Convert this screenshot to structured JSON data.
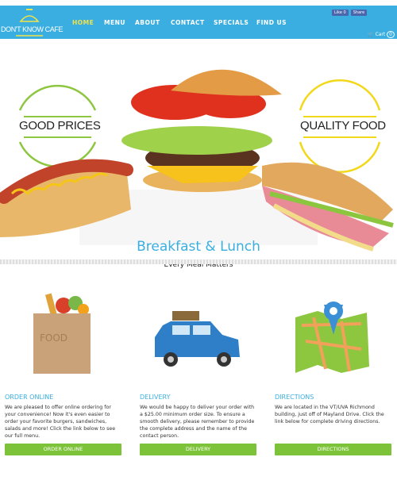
{
  "header": {
    "logo_text": "DON'T KNOW CAFE",
    "nav": [
      "HOME",
      "MENU",
      "ABOUT",
      "CONTACT",
      "SPECIALS",
      "FIND US"
    ],
    "active": "HOME",
    "fb_like": "Like 0",
    "fb_share": "Share",
    "cart": "Cart",
    "cart_count": "0"
  },
  "hero": {
    "left_badge": "GOOD PRICES",
    "right_badge": "QUALITY FOOD",
    "title": "Breakfast & Lunch",
    "subtitle": "Every Meal Matters",
    "bag_label": "FOOD"
  },
  "features": [
    {
      "title": "ORDER ONLINE",
      "text": "We are pleased to offer online ordering for your convenience! Now it's even easier to order your favorite burgers, sandwiches, salads and more! Click the link below to see our full menu.",
      "button": "ORDER ONLINE"
    },
    {
      "title": "DELIVERY",
      "text": "We would be happy to deliver your order with a $25.00 minimum order size. To ensure a smooth delivery, please remember to provide the complete address and the name of the contact person.",
      "button": "DELIVERY"
    },
    {
      "title": "DIRECTIONS",
      "text": "We are located in the VT/UVA Richmond building, just off of Mayland Drive. Click the link below for complete driving directions.",
      "button": "DIRECTIONS"
    }
  ],
  "colors": {
    "brand": "#3aaee0",
    "accent": "#f2e24a",
    "button": "#7dc33a"
  }
}
